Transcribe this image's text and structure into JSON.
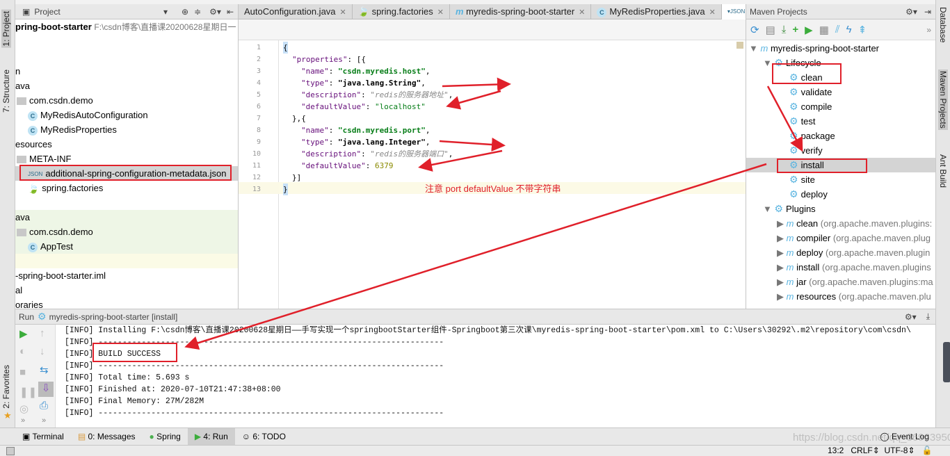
{
  "left_strip": {
    "tabs": [
      "1: Project",
      "7: Structure",
      "2: Favorites"
    ]
  },
  "right_strip": {
    "tabs": [
      "Database",
      "Maven Projects",
      "Ant Build"
    ]
  },
  "project": {
    "title": "Project",
    "root_name": "pring-boot-starter",
    "root_path": "F:\\csdn博客\\直播课20200628星期日一",
    "rows": [
      "n",
      "ava",
      "com.csdn.demo",
      "MyRedisAutoConfiguration",
      "MyRedisProperties",
      "esources",
      "META-INF",
      "additional-spring-configuration-metadata.json",
      "spring.factories",
      "ava",
      "com.csdn.demo",
      "AppTest",
      "-spring-boot-starter.iml",
      "al",
      "oraries"
    ]
  },
  "editor": {
    "tabs": [
      "AutoConfiguration.java",
      "spring.factories",
      "myredis-spring-boot-starter",
      "MyRedisProperties.java"
    ],
    "line_numbers": [
      "1",
      "2",
      "3",
      "4",
      "5",
      "6",
      "7",
      "8",
      "9",
      "10",
      "11",
      "12",
      "13"
    ],
    "code": {
      "l1": "{",
      "l2k": "\"properties\"",
      "l2r": ": [{",
      "name": "\"name\"",
      "type": "\"type\"",
      "description": "\"description\"",
      "defaultValue": "\"defaultValue\"",
      "host": "\"csdn.myredis.host\"",
      "string_type": "\"java.lang.String\"",
      "host_desc": "\"redis的服务器地址\"",
      "localhost": "\"localhost\"",
      "l7": "},{",
      "port": "\"csdn.myredis.port\"",
      "int_type": "\"java.lang.Integer\"",
      "port_desc": "\"redis的服务器端口\"",
      "port_val": "6379",
      "l12": "}]",
      "l13": "}"
    },
    "annotation": "注意 port defaultValue 不带字符串"
  },
  "maven": {
    "title": "Maven Projects",
    "project": "myredis-spring-boot-starter",
    "lifecycle_label": "Lifecycle",
    "lifecycle": [
      "clean",
      "validate",
      "compile",
      "test",
      "package",
      "verify",
      "install",
      "site",
      "deploy"
    ],
    "plugins_label": "Plugins",
    "plugins": [
      {
        "name": "clean",
        "detail": "(org.apache.maven.plugins:"
      },
      {
        "name": "compiler",
        "detail": "(org.apache.maven.plug"
      },
      {
        "name": "deploy",
        "detail": "(org.apache.maven.plugin"
      },
      {
        "name": "install",
        "detail": "(org.apache.maven.plugins"
      },
      {
        "name": "jar",
        "detail": "(org.apache.maven.plugins:ma"
      },
      {
        "name": "resources",
        "detail": "(org.apache.maven.plu"
      }
    ]
  },
  "run": {
    "label": "Run",
    "config": "myredis-spring-boot-starter [install]",
    "lines": [
      "[INFO] Installing F:\\csdn博客\\直播课20200628星期日——手写实现一个springbootStarter组件-Springboot第三次课\\myredis-spring-boot-starter\\pom.xml to C:\\Users\\30292\\.m2\\repository\\com\\csdn\\",
      "[INFO] ------------------------------------------------------------------------",
      "[INFO] BUILD SUCCESS",
      "[INFO] ------------------------------------------------------------------------",
      "[INFO] Total time: 5.693 s",
      "[INFO] Finished at: 2020-07-10T21:47:38+08:00",
      "[INFO] Final Memory: 27M/282M",
      "[INFO] ------------------------------------------------------------------------"
    ]
  },
  "bottom_tabs": [
    "Terminal",
    "0: Messages",
    "Spring",
    "4: Run",
    "6: TODO"
  ],
  "event_log": "Event Log",
  "status": {
    "position": "13:2",
    "line_sep": "CRLF",
    "encoding": "UTF-8"
  },
  "watermark": "https://blog.csdn.net/qq_36963950",
  "colors": {
    "annotation": "#e0202a",
    "maven_gear": "#5ab4e0",
    "run_green": "#3cad3c"
  }
}
